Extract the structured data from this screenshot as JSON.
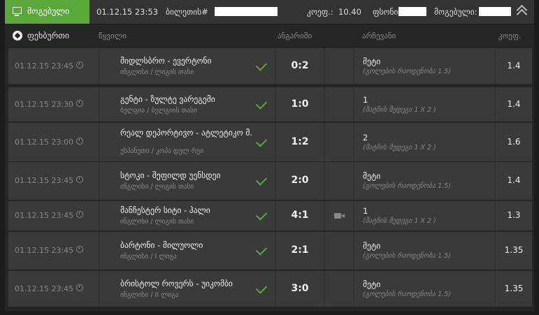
{
  "topbar": {
    "status_label": "მოგებული",
    "date": "01.12.15 23:53",
    "ticket_label": "ბილეთის#",
    "coef_label": "კოეფ.:",
    "coef_value": "10.40",
    "stake_label": "ფსონი:",
    "win_label": "მოგებული:"
  },
  "header": {
    "sport": "ფეხბურთი",
    "col_event": "წყვილი",
    "col_score": "ანგარიში",
    "col_choice": "არჩევანი",
    "col_odds": "კოეფ."
  },
  "rows": [
    {
      "date": "01.12.15 23:45",
      "teams": "მიდლსბრო - ევერტონი",
      "league": "ინგლისი / ლიგის თასი",
      "score": "0:2",
      "choice": "მეტი",
      "market": "(გოლების რაოდენობა 1.5)",
      "odds": "1.4"
    },
    {
      "date": "01.12.15 23:30",
      "teams": "გენტი - ზულტე ვარეგემი",
      "league": "ბელგია / ბელგიის თასი",
      "score": "1:0",
      "choice": "1",
      "market": "(მატჩის შედეგი 1 X 2 )",
      "odds": "1.4"
    },
    {
      "date": "01.12.15 23:00",
      "teams": "რეალ დეპორტივო - ატლეტიკო მ.",
      "league": "ესპანეთი / კოპა დელ რეი",
      "score": "1:2",
      "choice": "2",
      "market": "(მატჩის შედეგი 1 X 2 )",
      "odds": "1.6"
    },
    {
      "date": "01.12.15 23:45",
      "teams": "სტოკი - შეფილდ უენსდეი",
      "league": "ინგლისი / ლიგის თასი",
      "score": "2:0",
      "choice": "მეტი",
      "market": "(გოლების რაოდენობა 1.5)",
      "odds": "1.4"
    },
    {
      "date": "01.12.15 23:45",
      "teams": "მანჩესტერ სიტი - ჰალი",
      "league": "ინგლისი / ლიგის თასი",
      "score": "4:1",
      "choice": "1",
      "market": "(მატჩის შედეგი 1 X 2 )",
      "odds": "1.3"
    },
    {
      "date": "01.12.15 23:45",
      "teams": "ბარტონი - მილუოლი",
      "league": "ინგლისი / I ლიგა",
      "score": "2:1",
      "choice": "მეტი",
      "market": "(გოლების რაოდენობა 1.5)",
      "odds": "1.35"
    },
    {
      "date": "01.12.15 23:45",
      "teams": "ბრისტოლ როვერს - უიკომბი",
      "league": "ინგლისი / II ლიგა",
      "score": "3:0",
      "choice": "მეტი",
      "market": "(გოლების რაოდენობა 1.5)",
      "odds": "1.35"
    }
  ]
}
